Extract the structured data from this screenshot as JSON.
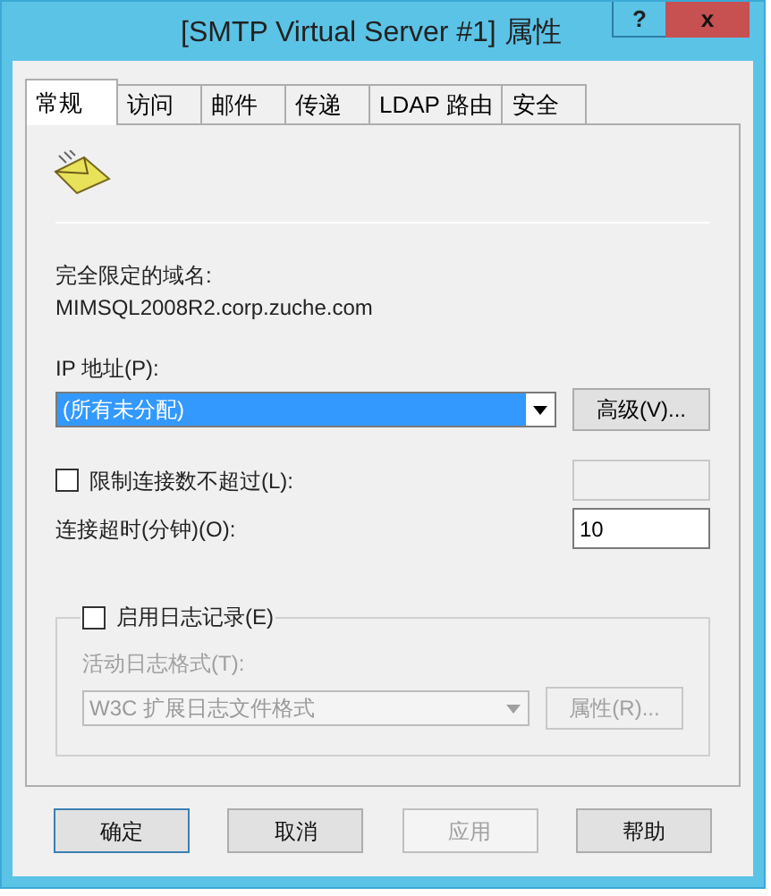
{
  "window": {
    "title": "[SMTP Virtual Server #1] 属性",
    "help": "?",
    "close": "x"
  },
  "tabs": [
    {
      "label": "常规",
      "selected": true
    },
    {
      "label": "访问",
      "selected": false
    },
    {
      "label": "邮件",
      "selected": false
    },
    {
      "label": "传递",
      "selected": false
    },
    {
      "label": "LDAP 路由",
      "selected": false
    },
    {
      "label": "安全",
      "selected": false
    }
  ],
  "fqdn": {
    "label": "完全限定的域名:",
    "value": "MIMSQL2008R2.corp.zuche.com"
  },
  "ip": {
    "label": "IP 地址(P):",
    "value": "(所有未分配)",
    "button": "高级(V)..."
  },
  "limit": {
    "label": "限制连接数不超过(L):",
    "checked": false,
    "value_disabled": true
  },
  "timeout": {
    "label": "连接超时(分钟)(O):",
    "value": "10"
  },
  "logging": {
    "label": "启用日志记录(E)",
    "checked": false,
    "format_label": "活动日志格式(T):",
    "format": "W3C 扩展日志文件格式",
    "button": "属性(R)..."
  },
  "buttons": [
    {
      "label": "确定",
      "default": true,
      "disabled": false
    },
    {
      "label": "取消",
      "default": false,
      "disabled": false
    },
    {
      "label": "应用",
      "default": false,
      "disabled": true
    },
    {
      "label": "帮助",
      "default": false,
      "disabled": false
    }
  ]
}
